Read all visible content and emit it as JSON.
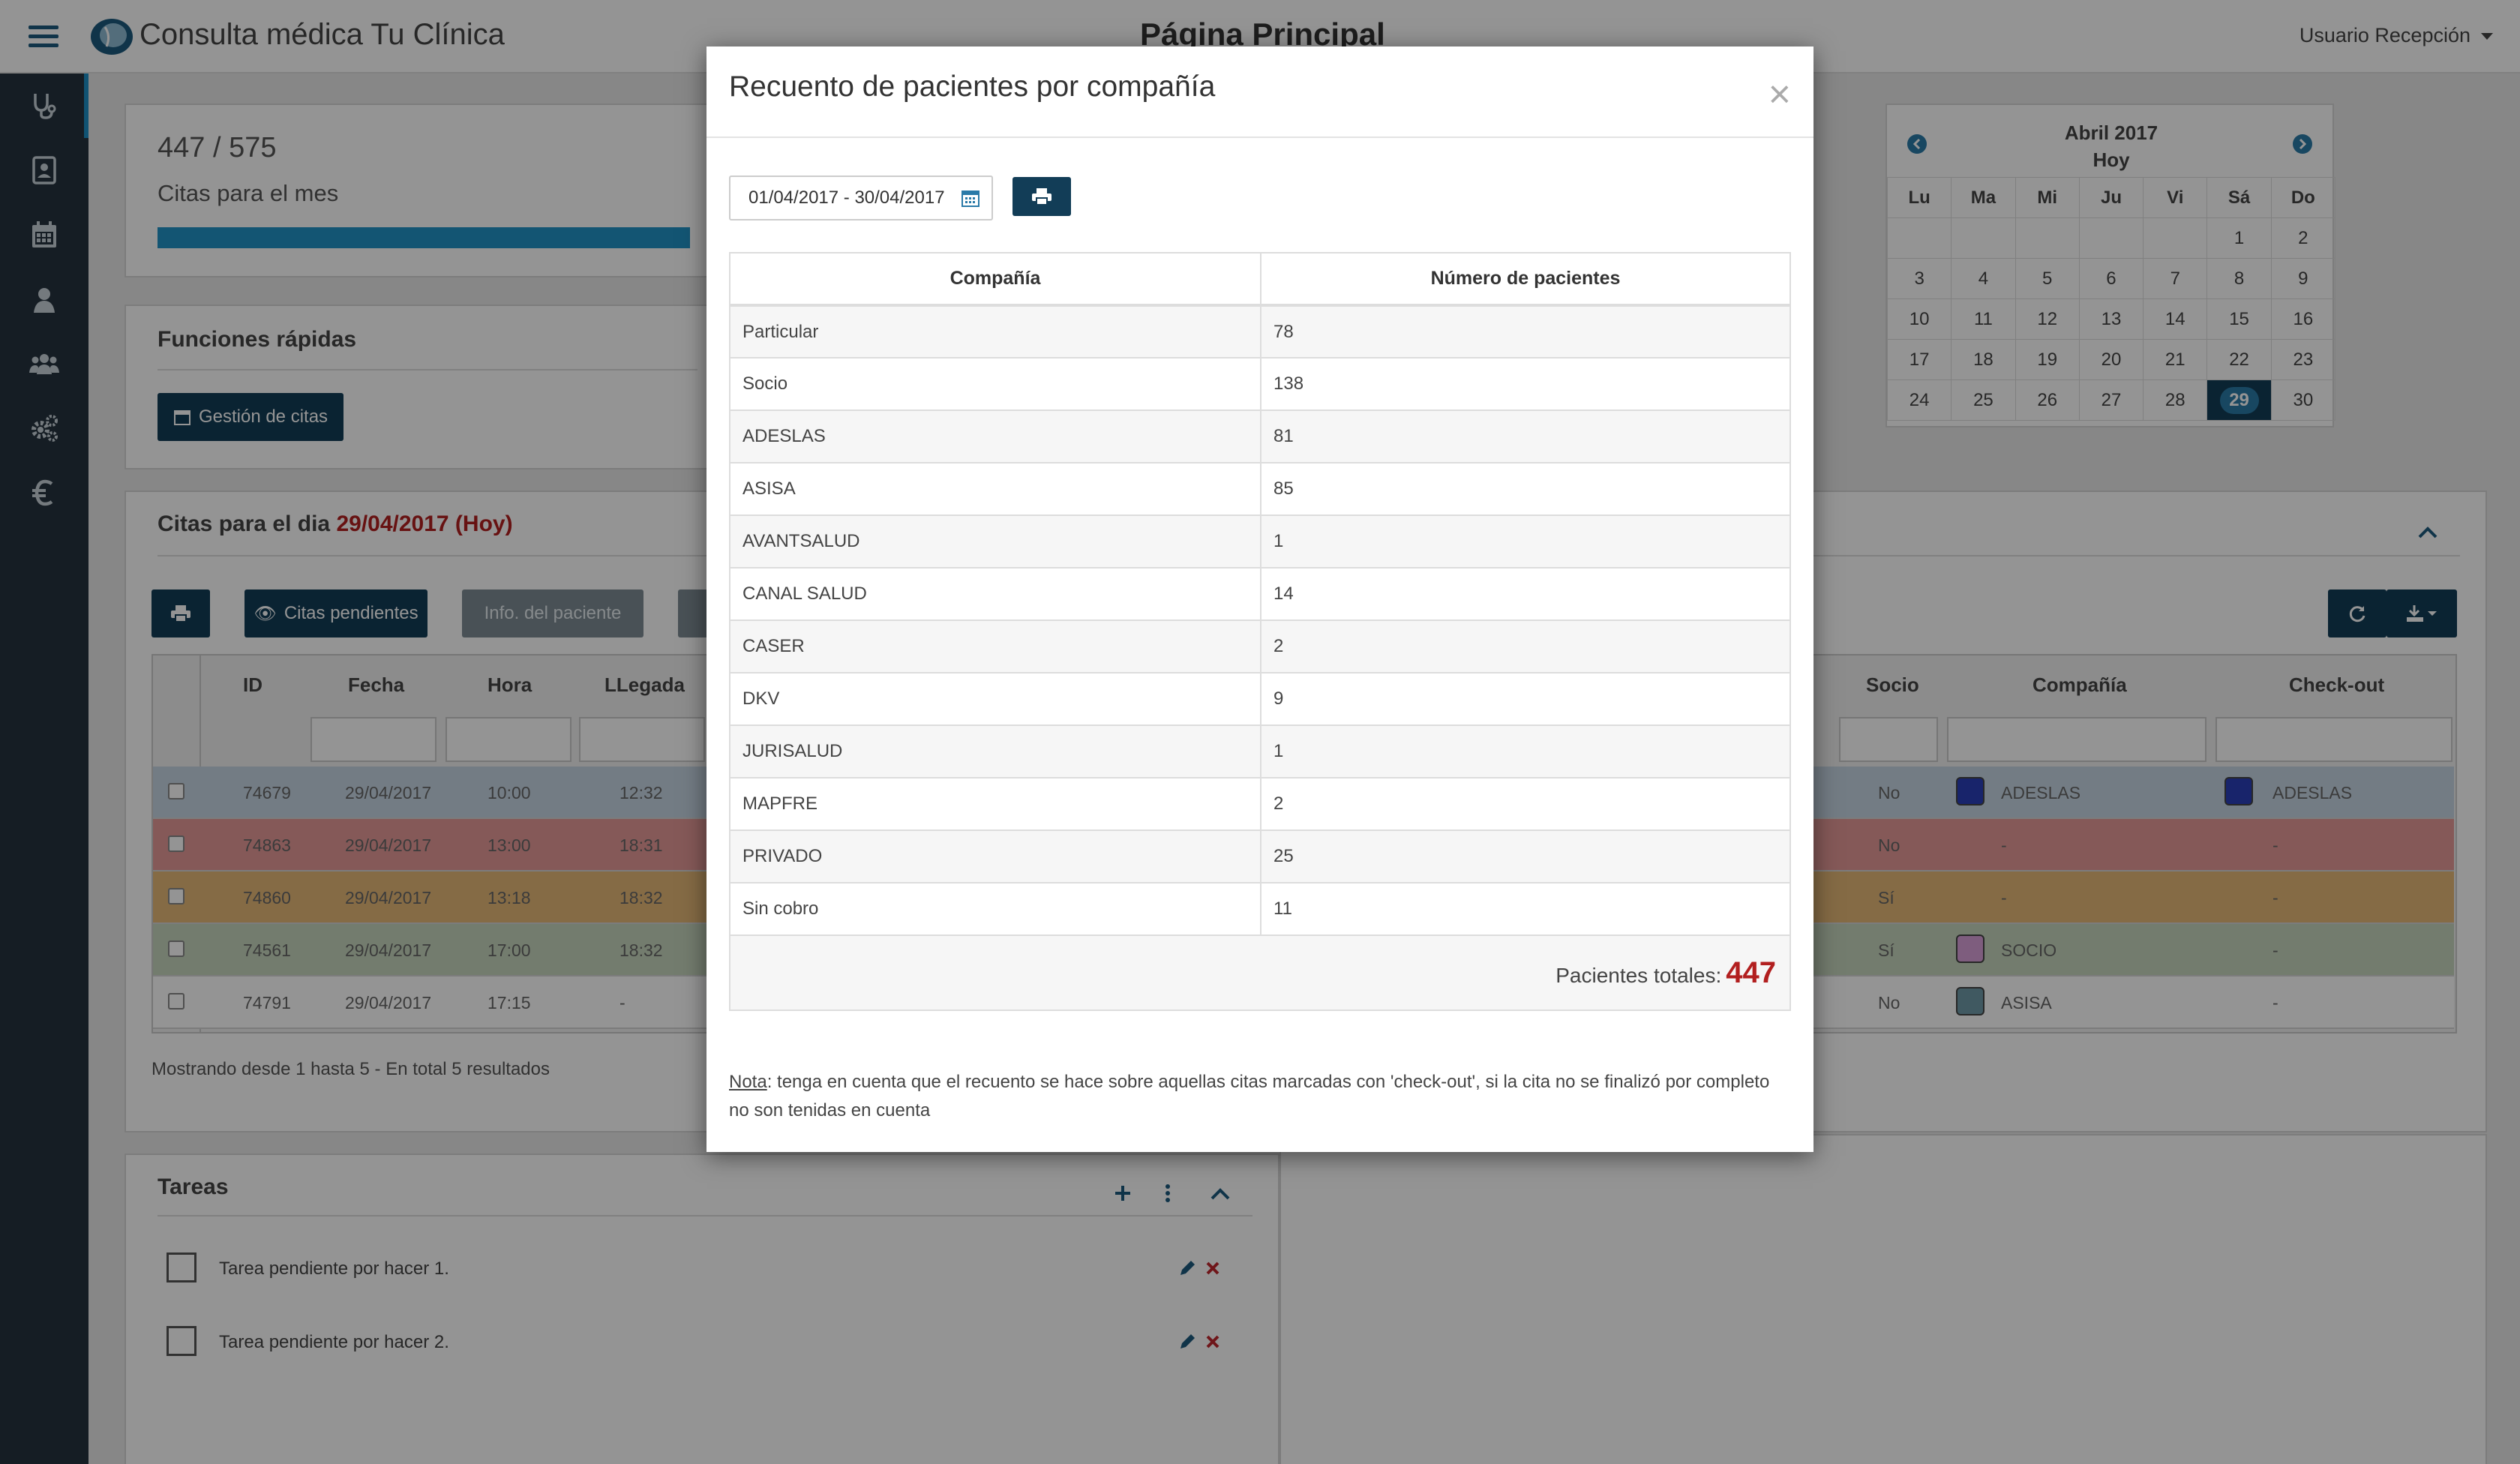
{
  "app": {
    "brand": "Consulta médica Tu Clínica",
    "page_title": "Página Principal",
    "user": "Usuario Recepción"
  },
  "stats": {
    "ratio": "447 / 575",
    "label": "Citas para el mes",
    "progress": 0.777
  },
  "quick": {
    "title": "Funciones rápidas",
    "appointments_button": "Gestión de citas"
  },
  "today": {
    "title_prefix": "Citas para el dia",
    "date": "29/04/2017 (Hoy)",
    "pending_button": "Citas pendientes",
    "patient_info_button": "Info. del paciente",
    "left_headers": [
      "ID",
      "Fecha",
      "Hora",
      "LLegada"
    ],
    "right_headers": [
      "Socio",
      "Compañía",
      "Check-out"
    ],
    "rows": [
      {
        "id": "74679",
        "fecha": "29/04/2017",
        "hora": "10:00",
        "llegada": "12:32",
        "socio": "No",
        "compania": "ADESLAS",
        "checkout": "ADESLAS",
        "color": "#c7d6e3",
        "swatch": "#2a3fb8"
      },
      {
        "id": "74863",
        "fecha": "29/04/2017",
        "hora": "13:00",
        "llegada": "18:31",
        "socio": "No",
        "compania": "-",
        "checkout": "-",
        "color": "#e59a98",
        "swatch": ""
      },
      {
        "id": "74860",
        "fecha": "29/04/2017",
        "hora": "13:18",
        "llegada": "18:32",
        "socio": "Sí",
        "compania": "-",
        "checkout": "-",
        "color": "#e6b878",
        "swatch": ""
      },
      {
        "id": "74561",
        "fecha": "29/04/2017",
        "hora": "17:00",
        "llegada": "18:32",
        "socio": "Sí",
        "compania": "SOCIO",
        "checkout": "-",
        "color": "#c6d6bd",
        "swatch": "#d9a0d9"
      },
      {
        "id": "74791",
        "fecha": "29/04/2017",
        "hora": "17:15",
        "llegada": "-",
        "socio": "No",
        "compania": "ASISA",
        "checkout": "-",
        "color": "#ffffff",
        "swatch": "#6f9aa8"
      }
    ],
    "footer": "Mostrando desde 1 hasta 5 - En total 5 resultados"
  },
  "tasks": {
    "title": "Tareas",
    "items": [
      "Tarea pendiente por hacer 1.",
      "Tarea pendiente por hacer 2."
    ]
  },
  "calendar": {
    "month": "Abril 2017",
    "today_label": "Hoy",
    "weekdays": [
      "Lu",
      "Ma",
      "Mi",
      "Ju",
      "Vi",
      "Sá",
      "Do"
    ],
    "weeks": [
      [
        "",
        "",
        "",
        "",
        "",
        "1",
        "2"
      ],
      [
        "3",
        "4",
        "5",
        "6",
        "7",
        "8",
        "9"
      ],
      [
        "10",
        "11",
        "12",
        "13",
        "14",
        "15",
        "16"
      ],
      [
        "17",
        "18",
        "19",
        "20",
        "21",
        "22",
        "23"
      ],
      [
        "24",
        "25",
        "26",
        "27",
        "28",
        "29",
        "30"
      ]
    ],
    "today": "29"
  },
  "modal": {
    "title": "Recuento de pacientes por compañía",
    "close": "×",
    "date_range": "01/04/2017 - 30/04/2017",
    "headers": [
      "Compañía",
      "Número de pacientes"
    ],
    "rows": [
      [
        "Particular",
        "78"
      ],
      [
        "Socio",
        "138"
      ],
      [
        "ADESLAS",
        "81"
      ],
      [
        "ASISA",
        "85"
      ],
      [
        "AVANTSALUD",
        "1"
      ],
      [
        "CANAL SALUD",
        "14"
      ],
      [
        "CASER",
        "2"
      ],
      [
        "DKV",
        "9"
      ],
      [
        "JURISALUD",
        "1"
      ],
      [
        "MAPFRE",
        "2"
      ],
      [
        "PRIVADO",
        "25"
      ],
      [
        "Sin cobro",
        "11"
      ]
    ],
    "total_label": "Pacientes totales:",
    "total_value": "447",
    "note_label": "Nota",
    "note_text": ": tenga en cuenta que el recuento se hace sobre aquellas citas marcadas con 'check-out', si la cita no se finalizó por completo no son tenidas en cuenta"
  }
}
